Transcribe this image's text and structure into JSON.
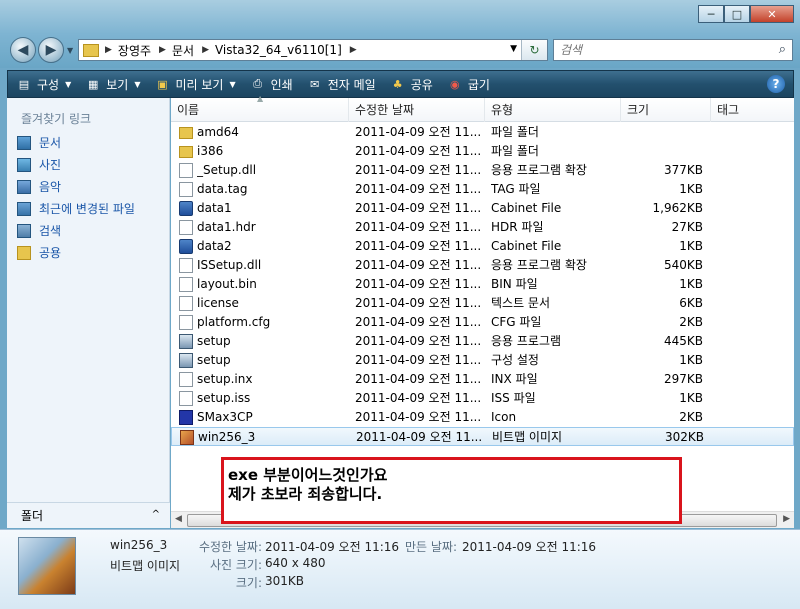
{
  "window": {
    "buttons": {
      "minimize": "─",
      "maximize": "□",
      "close": "✕"
    }
  },
  "address": {
    "crumbs": [
      "장영주",
      "문서",
      "Vista32_64_v6110[1]"
    ]
  },
  "search": {
    "placeholder": "검색"
  },
  "toolbar": {
    "items": [
      {
        "label": "구성",
        "icon": "organize-icon"
      },
      {
        "label": "보기",
        "icon": "views-icon"
      },
      {
        "label": "미리 보기",
        "icon": "preview-icon"
      },
      {
        "label": "인쇄",
        "icon": "print-icon"
      },
      {
        "label": "전자 메일",
        "icon": "email-icon"
      },
      {
        "label": "공유",
        "icon": "share-icon"
      },
      {
        "label": "굽기",
        "icon": "burn-icon"
      }
    ],
    "help": "?"
  },
  "sidebar": {
    "header": "즐겨찾기 링크",
    "links": [
      {
        "label": "문서",
        "icon": "documents-icon"
      },
      {
        "label": "사진",
        "icon": "pictures-icon"
      },
      {
        "label": "음악",
        "icon": "music-icon"
      },
      {
        "label": "최근에 변경된 파일",
        "icon": "recent-icon"
      },
      {
        "label": "검색",
        "icon": "searches-icon"
      },
      {
        "label": "공용",
        "icon": "public-folder-icon"
      }
    ],
    "folders_label": "폴더",
    "folders_arrow": "^"
  },
  "columns": [
    "이름",
    "수정한 날짜",
    "유형",
    "크기",
    "태그"
  ],
  "files": [
    {
      "name": "amd64",
      "date": "2011-04-09 오전 11...",
      "type": "파일 폴더",
      "size": "",
      "icon": "folder"
    },
    {
      "name": "i386",
      "date": "2011-04-09 오전 11...",
      "type": "파일 폴더",
      "size": "",
      "icon": "folder"
    },
    {
      "name": "_Setup.dll",
      "date": "2011-04-09 오전 11...",
      "type": "응용 프로그램 확장",
      "size": "377KB",
      "icon": "dll"
    },
    {
      "name": "data.tag",
      "date": "2011-04-09 오전 11...",
      "type": "TAG 파일",
      "size": "1KB",
      "icon": "file"
    },
    {
      "name": "data1",
      "date": "2011-04-09 오전 11...",
      "type": "Cabinet File",
      "size": "1,962KB",
      "icon": "cab"
    },
    {
      "name": "data1.hdr",
      "date": "2011-04-09 오전 11...",
      "type": "HDR 파일",
      "size": "27KB",
      "icon": "file"
    },
    {
      "name": "data2",
      "date": "2011-04-09 오전 11...",
      "type": "Cabinet File",
      "size": "1KB",
      "icon": "cab"
    },
    {
      "name": "ISSetup.dll",
      "date": "2011-04-09 오전 11...",
      "type": "응용 프로그램 확장",
      "size": "540KB",
      "icon": "dll"
    },
    {
      "name": "layout.bin",
      "date": "2011-04-09 오전 11...",
      "type": "BIN 파일",
      "size": "1KB",
      "icon": "file"
    },
    {
      "name": "license",
      "date": "2011-04-09 오전 11...",
      "type": "텍스트 문서",
      "size": "6KB",
      "icon": "file"
    },
    {
      "name": "platform.cfg",
      "date": "2011-04-09 오전 11...",
      "type": "CFG 파일",
      "size": "2KB",
      "icon": "file"
    },
    {
      "name": "setup",
      "date": "2011-04-09 오전 11...",
      "type": "응용 프로그램",
      "size": "445KB",
      "icon": "exe"
    },
    {
      "name": "setup",
      "date": "2011-04-09 오전 11...",
      "type": "구성 설정",
      "size": "1KB",
      "icon": "exe"
    },
    {
      "name": "setup.inx",
      "date": "2011-04-09 오전 11...",
      "type": "INX 파일",
      "size": "297KB",
      "icon": "file"
    },
    {
      "name": "setup.iss",
      "date": "2011-04-09 오전 11...",
      "type": "ISS 파일",
      "size": "1KB",
      "icon": "file"
    },
    {
      "name": "SMax3CP",
      "date": "2011-04-09 오전 11...",
      "type": "Icon",
      "size": "2KB",
      "icon": "ico"
    },
    {
      "name": "win256_3",
      "date": "2011-04-09 오전 11...",
      "type": "비트맵 이미지",
      "size": "302KB",
      "icon": "bmp",
      "selected": true
    }
  ],
  "note": {
    "line1": "exe 부분이어느것인가요",
    "line2": "제가 초보라 죄송합니다."
  },
  "details": {
    "name": "win256_3",
    "type": "비트맵 이미지",
    "modified_label": "수정한 날짜:",
    "modified_value": "2011-04-09 오전 11:16",
    "created_label": "만든 날짜:",
    "created_value": "2011-04-09 오전 11:16",
    "dimensions_label": "사진 크기:",
    "dimensions_value": "640 x 480",
    "size_label": "크기:",
    "size_value": "301KB"
  }
}
